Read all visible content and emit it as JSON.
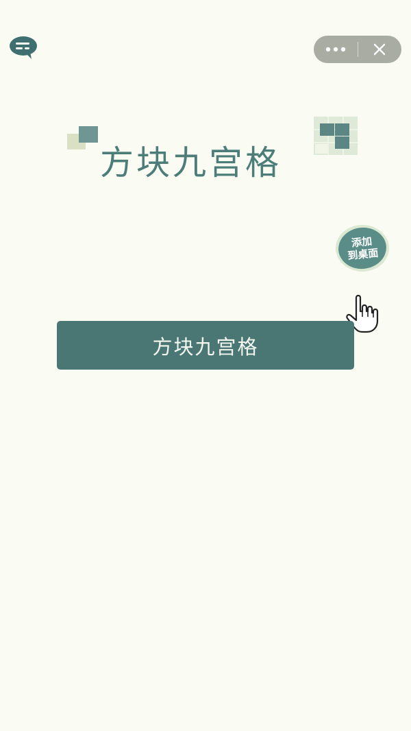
{
  "topbar": {
    "feedback_icon": "chat-bubble-icon",
    "more_icon": "more-dots-icon",
    "close_icon": "close-icon"
  },
  "logo": {
    "title": "方块九宫格"
  },
  "badge": {
    "line1": "添加",
    "line2": "到桌面"
  },
  "hand_icon": "pointing-hand-icon",
  "start_button": {
    "label": "方块九宫格"
  },
  "colors": {
    "background": "#fafbf3",
    "primary": "#4a7774",
    "badge": "#5b8d88",
    "capsule": "#a9aca2"
  }
}
